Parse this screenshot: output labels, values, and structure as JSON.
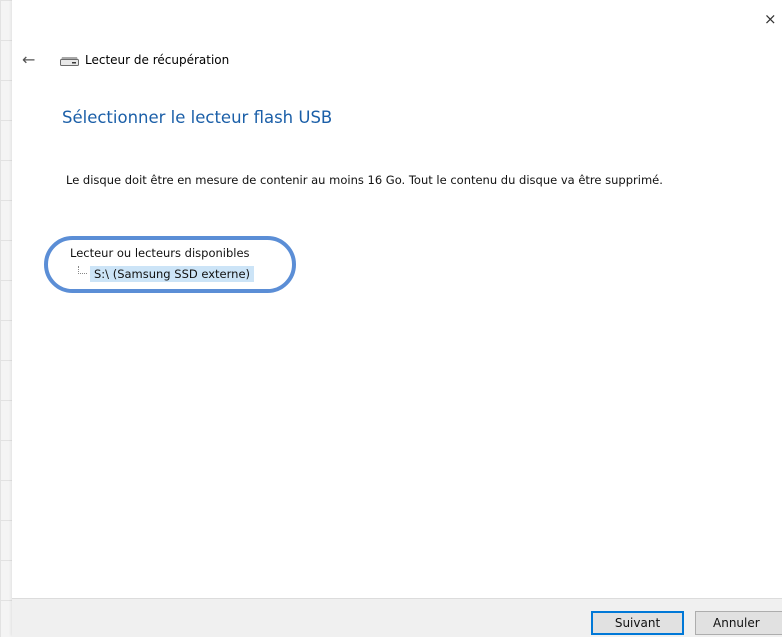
{
  "window": {
    "title": "Lecteur de récupération",
    "close_glyph": "×",
    "back_glyph": "←"
  },
  "page": {
    "heading": "Sélectionner le lecteur flash USB",
    "description": "Le disque doit être en mesure de contenir au moins 16 Go. Tout le contenu du disque va être supprimé."
  },
  "drives": {
    "header": "Lecteur ou lecteurs disponibles",
    "items": [
      {
        "label": "S:\\ (Samsung SSD externe)"
      }
    ]
  },
  "footer": {
    "next_label": "Suivant",
    "cancel_label": "Annuler"
  },
  "colors": {
    "heading": "#1b5fa8",
    "selection": "#cce4f7",
    "highlight_ring": "#5b8ed6",
    "primary_button_border": "#0078d7"
  }
}
